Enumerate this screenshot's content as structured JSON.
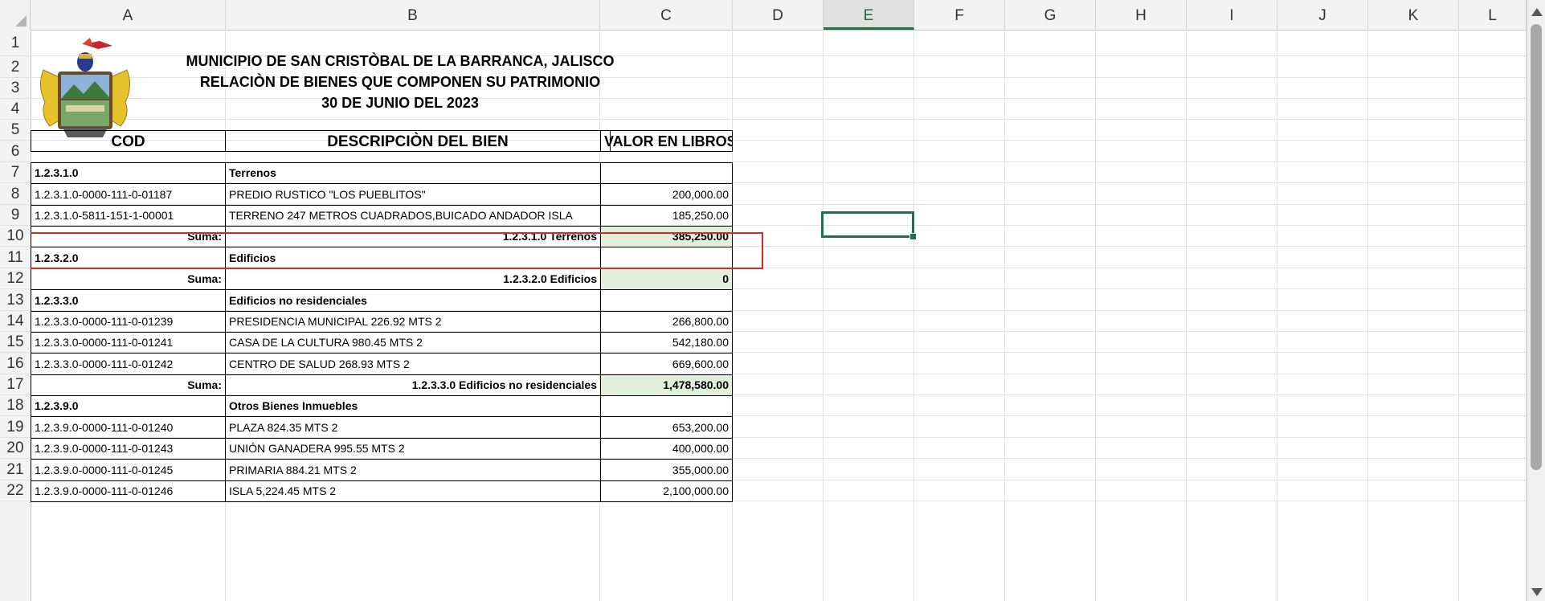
{
  "columns": [
    "A",
    "B",
    "C",
    "D",
    "E",
    "F",
    "G",
    "H",
    "I",
    "J",
    "K",
    "L"
  ],
  "selected_column": "E",
  "rows": [
    "1",
    "2",
    "3",
    "4",
    "5",
    "6",
    "7",
    "8",
    "9",
    "10",
    "11",
    "12",
    "13",
    "14",
    "15",
    "16",
    "17",
    "18",
    "19",
    "20",
    "21",
    "22"
  ],
  "titles": {
    "line1": "MUNICIPIO DE SAN CRISTÒBAL DE LA BARRANCA, JALISCO",
    "line2": "RELACIÒN DE BIENES QUE COMPONEN SU PATRIMONIO",
    "line3": "30 DE JUNIO DEL 2023"
  },
  "headers": {
    "cod": "COD",
    "desc": "DESCRIPCIÒN DEL BIEN",
    "valor": "VALOR EN LIBROS"
  },
  "table": [
    {
      "row": "7",
      "type": "group",
      "cod": "1.2.3.1.0",
      "desc": "Terrenos",
      "valor": ""
    },
    {
      "row": "8",
      "type": "item",
      "cod": "1.2.3.1.0-0000-111-0-01187",
      "desc": "PREDIO RUSTICO \"LOS PUEBLITOS\"",
      "valor": "200,000.00"
    },
    {
      "row": "9",
      "type": "item",
      "cod": "1.2.3.1.0-5811-151-1-00001",
      "desc": "TERRENO 247 METROS CUADRADOS,BUICADO ANDADOR ISLA",
      "valor": "185,250.00"
    },
    {
      "row": "10",
      "type": "sum",
      "cod": "Suma:",
      "desc": "1.2.3.1.0 Terrenos",
      "valor": "385,250.00"
    },
    {
      "row": "11",
      "type": "group",
      "cod": "1.2.3.2.0",
      "desc": "Edificios",
      "valor": ""
    },
    {
      "row": "12",
      "type": "sum",
      "cod": "Suma:",
      "desc": "1.2.3.2.0 Edificios",
      "valor": "0"
    },
    {
      "row": "13",
      "type": "group",
      "cod": "1.2.3.3.0",
      "desc": "Edificios no residenciales",
      "valor": ""
    },
    {
      "row": "14",
      "type": "item",
      "cod": "1.2.3.3.0-0000-111-0-01239",
      "desc": "PRESIDENCIA MUNICIPAL 226.92 MTS 2",
      "valor": "266,800.00"
    },
    {
      "row": "15",
      "type": "item",
      "cod": "1.2.3.3.0-0000-111-0-01241",
      "desc": "CASA DE LA CULTURA 980.45 MTS 2",
      "valor": "542,180.00"
    },
    {
      "row": "16",
      "type": "item",
      "cod": "1.2.3.3.0-0000-111-0-01242",
      "desc": "CENTRO DE SALUD 268.93 MTS 2",
      "valor": "669,600.00"
    },
    {
      "row": "17",
      "type": "sum",
      "cod": "Suma:",
      "desc": "1.2.3.3.0 Edificios no residenciales",
      "valor": "1,478,580.00"
    },
    {
      "row": "18",
      "type": "group",
      "cod": "1.2.3.9.0",
      "desc": "Otros Bienes Inmuebles",
      "valor": ""
    },
    {
      "row": "19",
      "type": "item",
      "cod": "1.2.3.9.0-0000-111-0-01240",
      "desc": "PLAZA 824.35 MTS 2",
      "valor": "653,200.00"
    },
    {
      "row": "20",
      "type": "item",
      "cod": "1.2.3.9.0-0000-111-0-01243",
      "desc": "UNIÓN GANADERA 995.55 MTS 2",
      "valor": "400,000.00"
    },
    {
      "row": "21",
      "type": "item",
      "cod": "1.2.3.9.0-0000-111-0-01245",
      "desc": "PRIMARIA 884.21 MTS 2",
      "valor": "355,000.00"
    },
    {
      "row": "22",
      "type": "item",
      "cod": "1.2.3.9.0-0000-111-0-01246",
      "desc": "ISLA 5,224.45 MTS 2",
      "valor": "2,100,000.00"
    }
  ],
  "colors": {
    "sum_fill": "#e2efda",
    "selection": "#1e7145",
    "highlight": "#e0252a"
  },
  "icons": {
    "logo": "municipal-coat-of-arms"
  }
}
